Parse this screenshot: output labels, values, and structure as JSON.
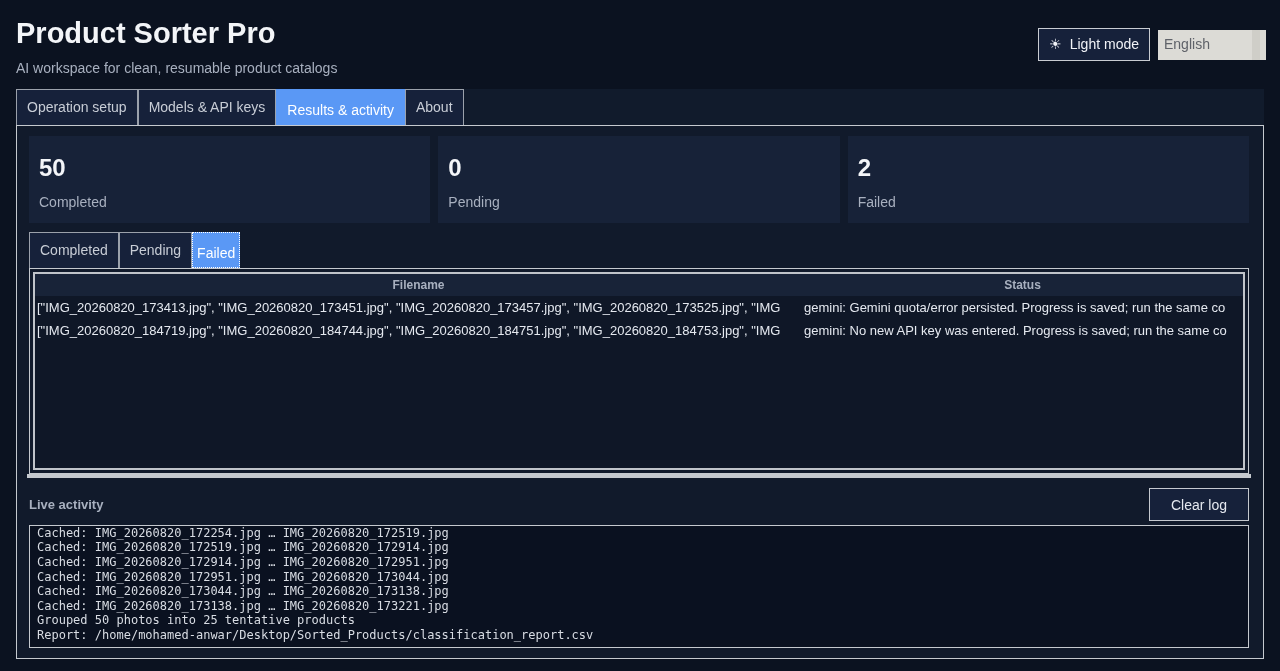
{
  "header": {
    "title": "Product Sorter Pro",
    "subtitle": "AI workspace for clean, resumable product catalogs",
    "theme_button": {
      "icon": "☀",
      "label": "Light mode"
    },
    "language": {
      "value": "English"
    }
  },
  "tabs": [
    {
      "label": "Operation setup",
      "selected": false
    },
    {
      "label": "Models & API keys",
      "selected": false
    },
    {
      "label": "Results & activity",
      "selected": true
    },
    {
      "label": "About",
      "selected": false
    }
  ],
  "stats": [
    {
      "value": "50",
      "label": "Completed"
    },
    {
      "value": "0",
      "label": "Pending"
    },
    {
      "value": "2",
      "label": "Failed"
    }
  ],
  "result_tabs": [
    {
      "label": "Completed",
      "selected": false
    },
    {
      "label": "Pending",
      "selected": false
    },
    {
      "label": "Failed",
      "selected": true
    }
  ],
  "table": {
    "columns": [
      "Filename",
      "Status"
    ],
    "rows": [
      [
        "[\"IMG_20260820_173413.jpg\", \"IMG_20260820_173451.jpg\", \"IMG_20260820_173457.jpg\", \"IMG_20260820_173525.jpg\", \"IMG",
        "gemini: Gemini quota/error persisted. Progress is saved; run the same co"
      ],
      [
        "[\"IMG_20260820_184719.jpg\", \"IMG_20260820_184744.jpg\", \"IMG_20260820_184751.jpg\", \"IMG_20260820_184753.jpg\", \"IMG",
        "gemini: No new API key was entered. Progress is saved; run the same co"
      ]
    ]
  },
  "activity": {
    "title": "Live activity",
    "clear_button": "Clear log",
    "log": [
      "Cached: IMG_20260820_172254.jpg … IMG_20260820_172519.jpg",
      "Cached: IMG_20260820_172519.jpg … IMG_20260820_172914.jpg",
      "Cached: IMG_20260820_172914.jpg … IMG_20260820_172951.jpg",
      "Cached: IMG_20260820_172951.jpg … IMG_20260820_173044.jpg",
      "Cached: IMG_20260820_173044.jpg … IMG_20260820_173138.jpg",
      "Cached: IMG_20260820_173138.jpg … IMG_20260820_173221.jpg",
      "Grouped 50 photos into 25 tentative products",
      "Report: /home/mohamed-anwar/Desktop/Sorted_Products/classification_report.csv"
    ]
  }
}
